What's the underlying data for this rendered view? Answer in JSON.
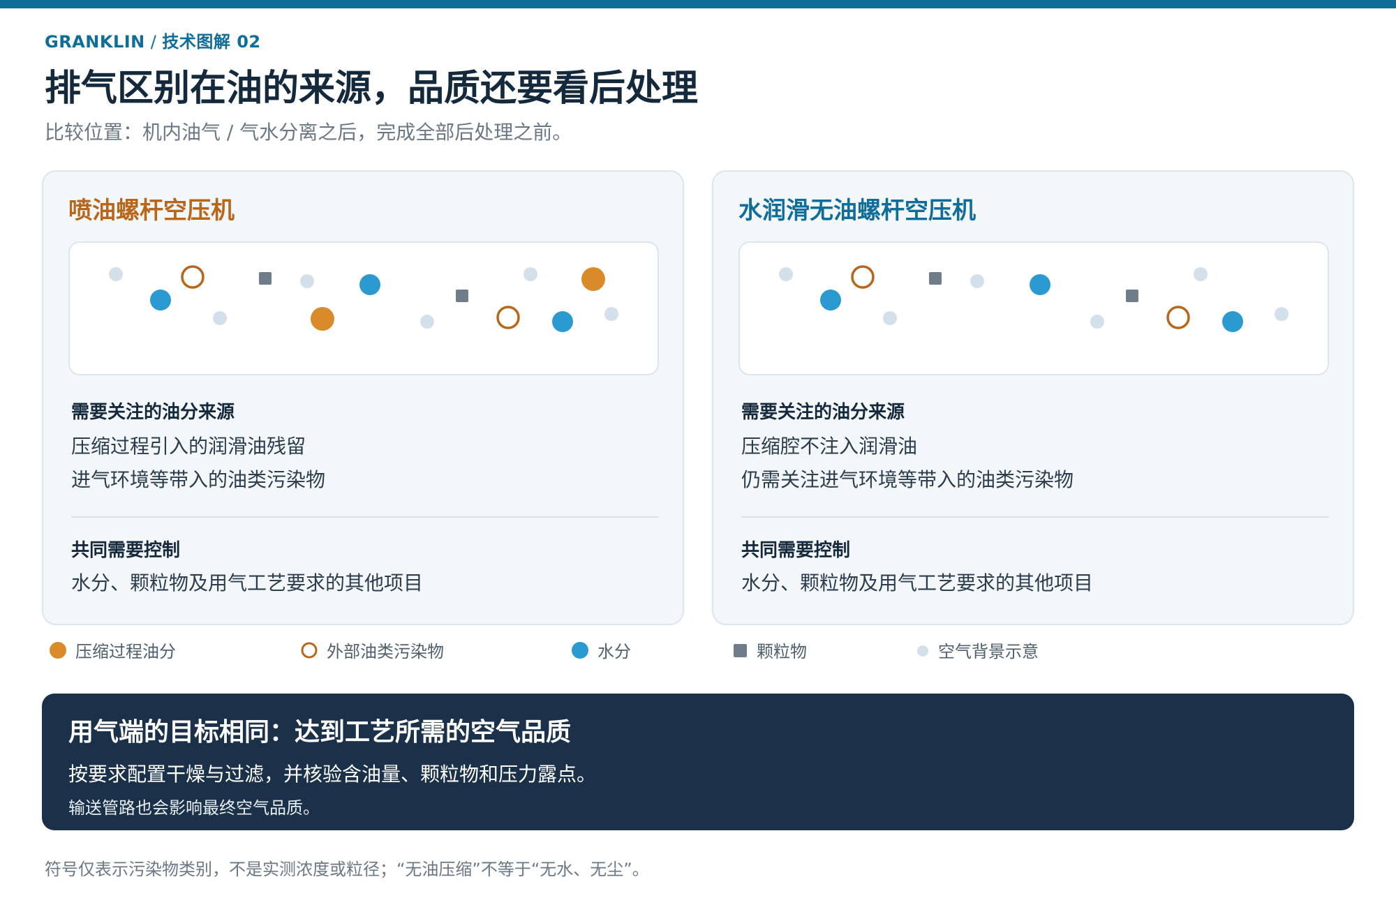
{
  "colors": {
    "accent": "#0f6d9a",
    "compression_oil": "#d98b2b",
    "external_oil": "#b8661a",
    "water": "#2a9ad1",
    "particle": "#6f7d8b",
    "air_background": "#d4e0e9",
    "banner_bg": "#1b3149"
  },
  "header": {
    "brand": "GRANKLIN",
    "separator": "/",
    "section": "技术图解 02",
    "title": "排气区别在油的来源，品质还要看后处理",
    "subtitle": "比较位置：机内油气 / 气水分离之后，完成全部后处理之前。"
  },
  "panels": [
    {
      "title": "喷油螺杆空压机",
      "oil_sources_heading": "需要关注的油分来源",
      "oil_sources": [
        "压缩过程引入的润滑油残留",
        "进气环境等带入的油类污染物"
      ],
      "common_heading": "共同需要控制",
      "common_items": [
        "水分、颗粒物及用气工艺要求的其他项目"
      ],
      "symbols": [
        "air-background",
        "external-oil",
        "particle",
        "air-background",
        "water",
        "particle",
        "air-background",
        "compression-oil",
        "water",
        "air-background",
        "compression-oil",
        "air-background",
        "external-oil",
        "water",
        "air-background"
      ]
    },
    {
      "title": "水润滑无油螺杆空压机",
      "oil_sources_heading": "需要关注的油分来源",
      "oil_sources": [
        "压缩腔不注入润滑油",
        "仍需关注进气环境等带入的油类污染物"
      ],
      "common_heading": "共同需要控制",
      "common_items": [
        "水分、颗粒物及用气工艺要求的其他项目"
      ],
      "symbols": [
        "air-background",
        "external-oil",
        "particle",
        "air-background",
        "water",
        "particle",
        "air-background",
        "water",
        "air-background",
        "air-background",
        "external-oil",
        "water",
        "air-background"
      ]
    }
  ],
  "legend": [
    {
      "icon": "compression-oil",
      "label": "压缩过程油分"
    },
    {
      "icon": "external-oil",
      "label": "外部油类污染物"
    },
    {
      "icon": "water",
      "label": "水分"
    },
    {
      "icon": "particle",
      "label": "颗粒物"
    },
    {
      "icon": "air-background",
      "label": "空气背景示意"
    }
  ],
  "banner": {
    "title": "用气端的目标相同：达到工艺所需的空气品质",
    "text": "按要求配置干燥与过滤，并核验含油量、颗粒物和压力露点。",
    "note": "输送管路也会影响最终空气品质。"
  },
  "footnote": "符号仅表示污染物类别，不是实测浓度或粒径；“无油压缩”不等于“无水、无尘”。"
}
